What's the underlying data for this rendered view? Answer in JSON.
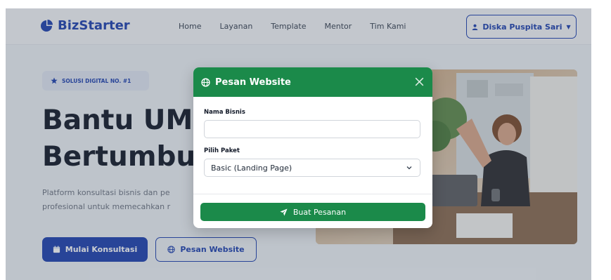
{
  "navbar": {
    "brand": "BizStarter",
    "links": [
      "Home",
      "Layanan",
      "Template",
      "Mentor",
      "Tim Kami"
    ],
    "user_name": "Diska Puspita Sari"
  },
  "hero": {
    "badge": "SOLUSI DIGITAL NO. #1",
    "title_line1": "Bantu UM",
    "title_line2": "Bertumbu",
    "desc_line1": "Platform konsultasi bisnis dan pe",
    "desc_line2": "profesional untuk memecahkan r",
    "primary_button": "Mulai Konsultasi",
    "secondary_button": "Pesan Website"
  },
  "modal": {
    "title": "Pesan Website",
    "business_name_label": "Nama Bisnis",
    "business_name_value": "",
    "package_label": "Pilih Paket",
    "package_selected": "Basic (Landing Page)",
    "submit_button": "Buat Pesanan"
  },
  "colors": {
    "brand_blue": "#1e40af",
    "modal_green": "#1b8a4a"
  },
  "icons": [
    "brand-icon",
    "user-icon",
    "star-icon",
    "calendar-icon",
    "globe-icon",
    "close-icon",
    "chevron-down-icon",
    "send-icon"
  ]
}
